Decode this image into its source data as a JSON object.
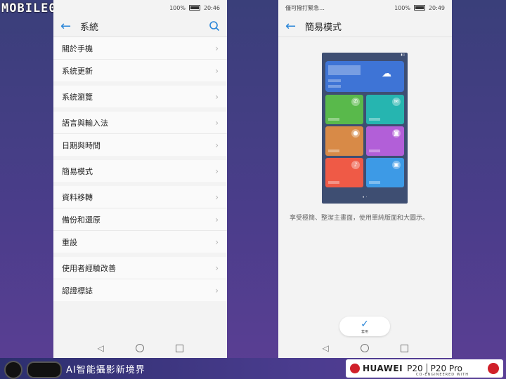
{
  "watermark": {
    "logo": "MOBILE01"
  },
  "left": {
    "status": {
      "left": "",
      "right_battery": "100%",
      "time": "20:46"
    },
    "title": "系統",
    "groups": [
      [
        "關於手機",
        "系統更新"
      ],
      [
        "系統瀏覽"
      ],
      [
        "語言與輸入法",
        "日期與時間"
      ],
      [
        "簡易模式"
      ],
      [
        "資料移轉",
        "備份和還原",
        "重設"
      ],
      [
        "使用者經驗改善",
        "認證標誌"
      ]
    ]
  },
  "right": {
    "status": {
      "left": "僅可撥打緊急…",
      "right_battery": "100%",
      "time": "20:49"
    },
    "title": "簡易模式",
    "description": "享受極簡、整潔主畫面，使用單純版面和大圖示。",
    "apply_label": "套用"
  },
  "banner": {
    "slogan": "AI智能攝影新境界",
    "brand": "HUAWEI",
    "model1": "P20",
    "model2": "P20 Pro",
    "coengineered": "CO-ENGINEERED WITH"
  },
  "colors": {
    "accent": "#2a86d8",
    "banner": "#4b3c8f",
    "huawei_red": "#d0202a"
  }
}
